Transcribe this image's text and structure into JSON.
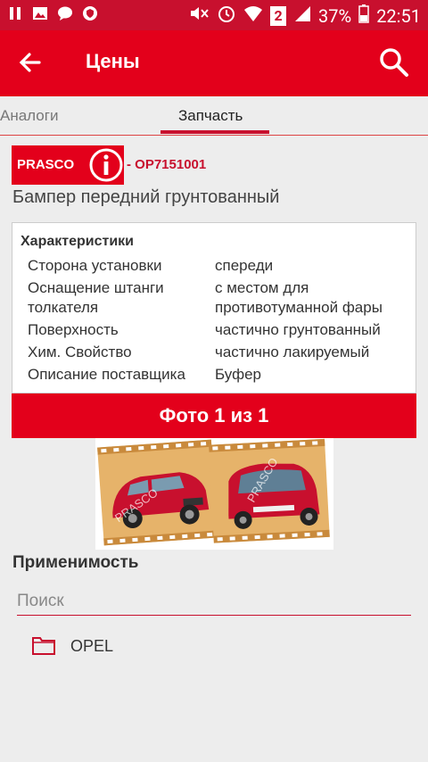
{
  "statusbar": {
    "battery_percent": "37%",
    "time": "22:51",
    "sim": "2",
    "icons": [
      "pause-icon",
      "image-icon",
      "message-icon",
      "shield-icon",
      "mute-icon",
      "alarm-icon",
      "wifi-icon",
      "signal-icon",
      "battery-icon"
    ]
  },
  "appbar": {
    "title": "Цены",
    "back_icon": "arrow-left-icon",
    "search_icon": "search-icon"
  },
  "tabs": [
    {
      "label": "Аналоги",
      "selected": false
    },
    {
      "label": "Запчасть",
      "selected": true
    }
  ],
  "part": {
    "brand": "PRASCO",
    "number": "- OP7151001",
    "name": "Бампер передний грунтованный"
  },
  "characteristics": {
    "title": "Характеристики",
    "rows": [
      {
        "key": "Сторона установки",
        "value": "спереди"
      },
      {
        "key": "Оснащение штанги толкателя",
        "value": "с местом для противотуманной фары"
      },
      {
        "key": "Поверхность",
        "value": "частично грунтованный"
      },
      {
        "key": "Хим. Свойство",
        "value": "частично лакируемый"
      },
      {
        "key": "Описание поставщика",
        "value": "Буфер"
      }
    ]
  },
  "photo": {
    "label": "Фото 1 из 1",
    "watermark": "PRASCO"
  },
  "applicability": {
    "title": "Применимость",
    "search_placeholder": "Поиск",
    "items": [
      {
        "label": "OPEL"
      }
    ]
  },
  "colors": {
    "primary": "#e3001b",
    "statusbar": "#c8102e"
  }
}
